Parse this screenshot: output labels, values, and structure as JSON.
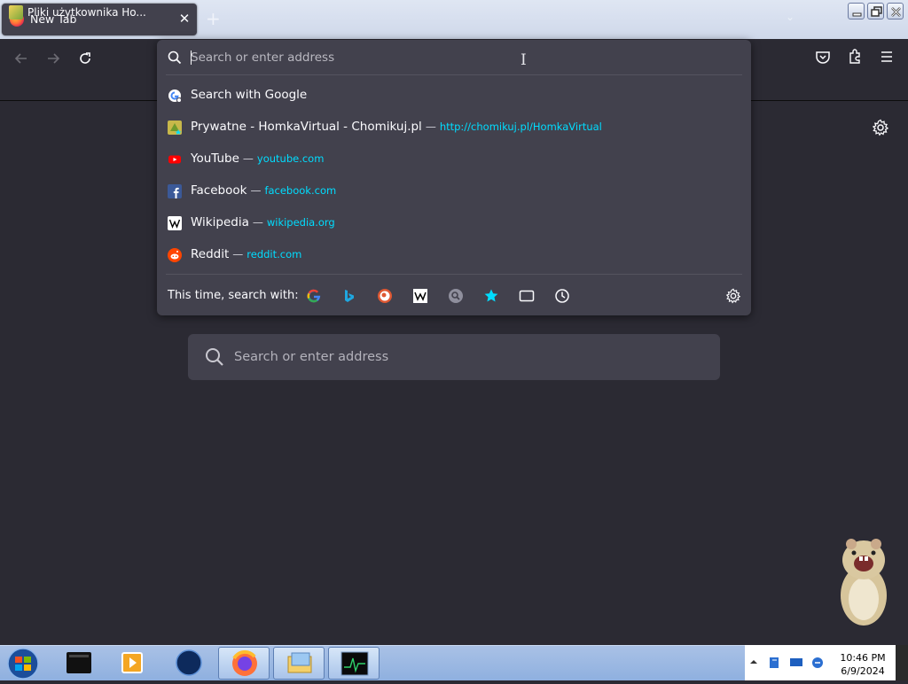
{
  "window": {
    "tab_title": "New Tab",
    "tab_close_label": "✕",
    "new_tab_label": "+",
    "tab_list_label": "⌄"
  },
  "toolbar": {
    "back": "back-arrow-icon",
    "forward": "forward-arrow-icon",
    "reload": "reload-icon",
    "pocket": "pocket-icon",
    "extensions": "extensions-icon",
    "menu": "hamburger-menu-icon"
  },
  "bookmarks": [
    {
      "label": "Pliki użytkownika Ho..."
    }
  ],
  "urlbar": {
    "placeholder": "Search or enter address",
    "value": "",
    "results": [
      {
        "title": "Search with Google",
        "url": "",
        "icon": "google-search-icon"
      },
      {
        "title": "Prywatne - HomkaVirtual - Chomikuj.pl",
        "url": "http://chomikuj.pl/HomkaVirtual",
        "icon": "bookmark-favicon"
      },
      {
        "title": "YouTube",
        "url": "youtube.com",
        "icon": "youtube-icon"
      },
      {
        "title": "Facebook",
        "url": "facebook.com",
        "icon": "facebook-icon"
      },
      {
        "title": "Wikipedia",
        "url": "wikipedia.org",
        "icon": "wikipedia-icon"
      },
      {
        "title": "Reddit",
        "url": "reddit.com",
        "icon": "reddit-icon"
      }
    ],
    "separator": "—",
    "one_off_label": "This time, search with:",
    "one_off_engines": [
      "google-icon",
      "bing-icon",
      "duckduckgo-icon",
      "wikipedia-icon",
      "search-engine-icon",
      "bookmarks-star-icon",
      "tabs-icon",
      "history-clock-icon"
    ]
  },
  "content_search": {
    "placeholder": "Search or enter address"
  },
  "taskbar": {
    "apps": [
      "terminal-app-icon",
      "media-player-icon",
      "globe-app-icon",
      "firefox-icon",
      "file-explorer-icon",
      "task-monitor-icon"
    ],
    "time": "10:46 PM",
    "date": "6/9/2024"
  },
  "colors": {
    "background": "#2b2a33",
    "popup": "#42414d",
    "url_accent": "#00ddff",
    "text": "#fbfbfe"
  }
}
